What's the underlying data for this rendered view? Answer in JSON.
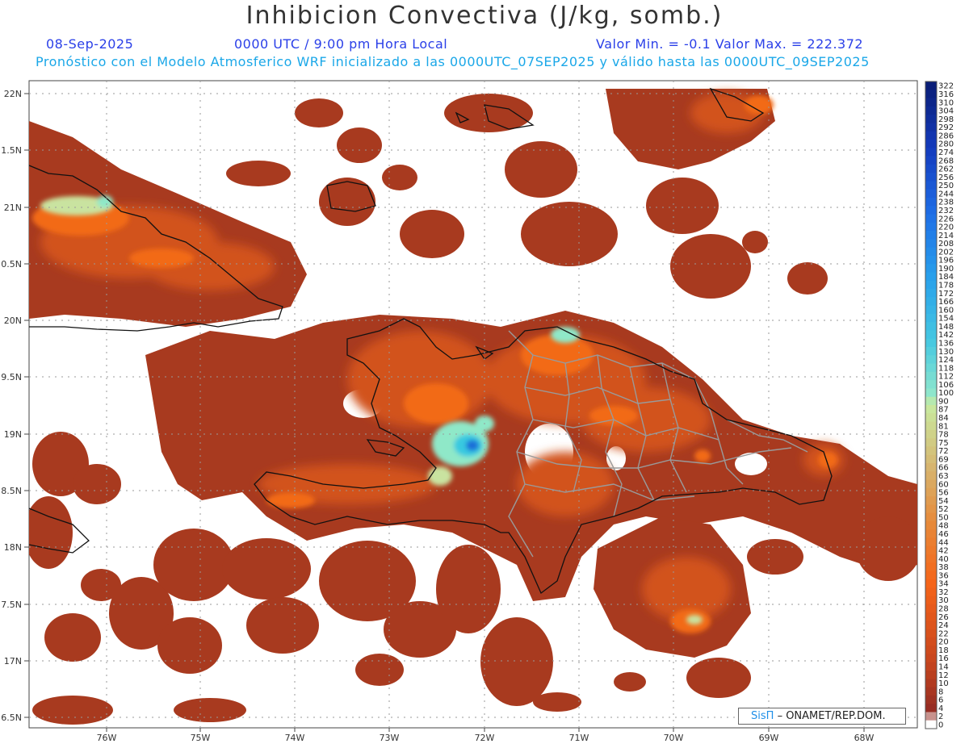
{
  "header": {
    "title": "Inhibicion Convectiva (J/kg, somb.)",
    "date": "08-Sep-2025",
    "time": "0000 UTC / 9:00 pm Hora Local",
    "minmax": "Valor Min. = -0.1  Valor Max. = 222.372",
    "model_line": "Pronóstico con el Modelo Atmosferico WRF inicializado a las 0000UTC_07SEP2025 y válido hasta las  0000UTC_09SEP2025"
  },
  "map": {
    "lat_labels": [
      "22N",
      "1.5N",
      "21N",
      "0.5N",
      "20N",
      "9.5N",
      "19N",
      "8.5N",
      "18N",
      "7.5N",
      "17N",
      "6.5N"
    ],
    "lon_labels": [
      "76W",
      "75W",
      "74W",
      "73W",
      "72W",
      "71W",
      "70W",
      "69W",
      "68W"
    ],
    "colors": {
      "base": "#a83a1f",
      "mid": "#d2521f",
      "high": "#f26a14",
      "mint": "#8fe8c8",
      "cyan": "#39c9e0",
      "blue": "#1d6fd8",
      "coast": "#111111",
      "border": "#9a9a9a",
      "grid": "#9a9a9a"
    }
  },
  "colorbar": {
    "labels": [
      "322",
      "316",
      "310",
      "304",
      "298",
      "292",
      "286",
      "280",
      "274",
      "268",
      "262",
      "256",
      "250",
      "244",
      "238",
      "232",
      "226",
      "220",
      "214",
      "208",
      "202",
      "196",
      "190",
      "184",
      "178",
      "172",
      "166",
      "160",
      "154",
      "148",
      "142",
      "136",
      "130",
      "124",
      "118",
      "112",
      "106",
      "100",
      "90",
      "87",
      "84",
      "81",
      "78",
      "75",
      "72",
      "69",
      "66",
      "63",
      "60",
      "56",
      "54",
      "52",
      "50",
      "48",
      "46",
      "44",
      "42",
      "40",
      "38",
      "36",
      "34",
      "32",
      "30",
      "28",
      "26",
      "24",
      "22",
      "20",
      "18",
      "16",
      "14",
      "12",
      "10",
      "8",
      "6",
      "4",
      "2",
      "0"
    ]
  },
  "credit": {
    "brand": "SisΠ",
    "text": "– ONAMET/REP.DOM."
  }
}
